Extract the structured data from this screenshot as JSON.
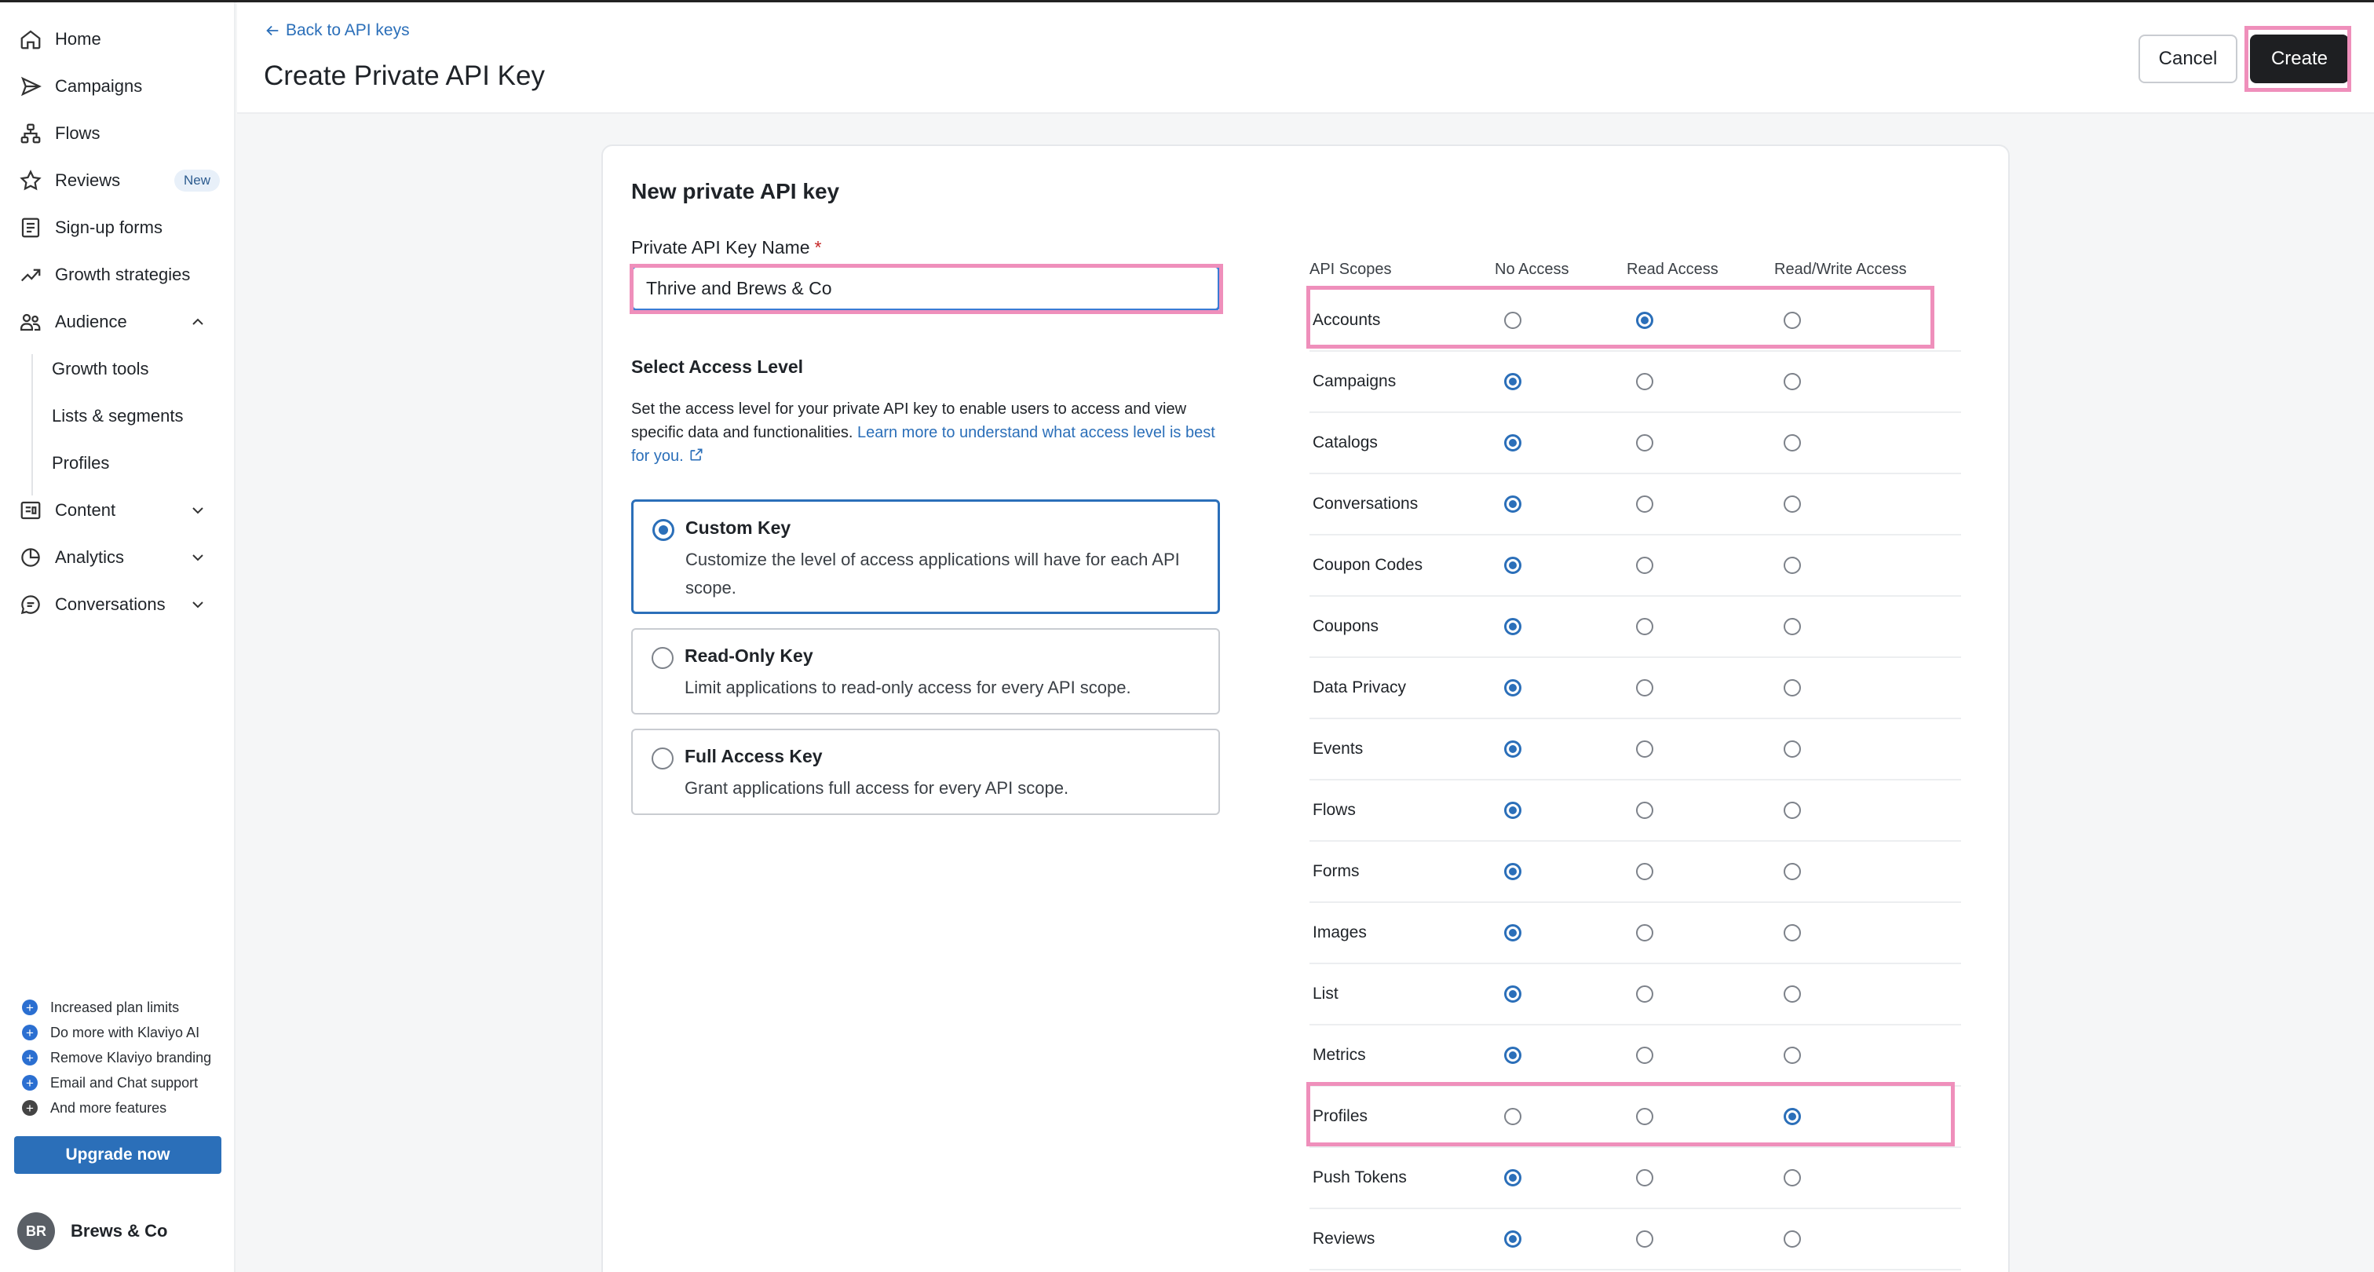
{
  "sidebar": {
    "nav": [
      {
        "id": "home",
        "label": "Home",
        "icon": "home-icon"
      },
      {
        "id": "campaigns",
        "label": "Campaigns",
        "icon": "send-icon"
      },
      {
        "id": "flows",
        "label": "Flows",
        "icon": "flow-icon"
      },
      {
        "id": "reviews",
        "label": "Reviews",
        "icon": "star-icon",
        "badge": "New"
      },
      {
        "id": "signup",
        "label": "Sign-up forms",
        "icon": "form-icon"
      },
      {
        "id": "growth",
        "label": "Growth strategies",
        "icon": "trend-icon"
      },
      {
        "id": "audience",
        "label": "Audience",
        "icon": "people-icon"
      }
    ],
    "audience_sub": [
      {
        "label": "Growth tools"
      },
      {
        "label": "Lists & segments"
      },
      {
        "label": "Profiles"
      }
    ],
    "nav_bottom": [
      {
        "label": "Content",
        "icon": "content-icon"
      },
      {
        "label": "Analytics",
        "icon": "analytics-icon"
      },
      {
        "label": "Conversations",
        "icon": "chat-icon"
      }
    ],
    "perks": [
      "Increased plan limits",
      "Do more with Klaviyo AI",
      "Remove Klaviyo branding",
      "Email and Chat support",
      "And more features"
    ],
    "upgrade_label": "Upgrade now",
    "account": {
      "initials": "BR",
      "name": "Brews & Co"
    }
  },
  "header": {
    "back_label": "Back to API keys",
    "title": "Create Private API Key",
    "cancel_label": "Cancel",
    "create_label": "Create"
  },
  "form": {
    "card_title": "New private API key",
    "name_label": "Private API Key Name",
    "required_mark": "*",
    "name_value": "Thrive and Brews & Co",
    "access_title": "Select Access Level",
    "access_desc": "Set the access level for your private API key to enable users to access and view specific data and functionalities.",
    "access_link": "Learn more to understand what access level is best for you.",
    "options": [
      {
        "title": "Custom Key",
        "desc": "Customize the level of access applications will have for each API scope.",
        "selected": true
      },
      {
        "title": "Read-Only Key",
        "desc": "Limit applications to read-only access for every API scope.",
        "selected": false
      },
      {
        "title": "Full Access Key",
        "desc": "Grant applications full access for every API scope.",
        "selected": false
      }
    ]
  },
  "scopes": {
    "headers": [
      "API Scopes",
      "No Access",
      "Read Access",
      "Read/Write Access"
    ],
    "rows": [
      {
        "name": "Accounts",
        "access": "read"
      },
      {
        "name": "Campaigns",
        "access": "none"
      },
      {
        "name": "Catalogs",
        "access": "none"
      },
      {
        "name": "Conversations",
        "access": "none"
      },
      {
        "name": "Coupon Codes",
        "access": "none"
      },
      {
        "name": "Coupons",
        "access": "none"
      },
      {
        "name": "Data Privacy",
        "access": "none"
      },
      {
        "name": "Events",
        "access": "none"
      },
      {
        "name": "Flows",
        "access": "none"
      },
      {
        "name": "Forms",
        "access": "none"
      },
      {
        "name": "Images",
        "access": "none"
      },
      {
        "name": "List",
        "access": "none"
      },
      {
        "name": "Metrics",
        "access": "none"
      },
      {
        "name": "Profiles",
        "access": "write"
      },
      {
        "name": "Push Tokens",
        "access": "none"
      },
      {
        "name": "Reviews",
        "access": "none"
      }
    ]
  },
  "colors": {
    "accent": "#2b6fb9",
    "highlight": "#ef8fbb",
    "primary_button": "#1e1f22"
  }
}
